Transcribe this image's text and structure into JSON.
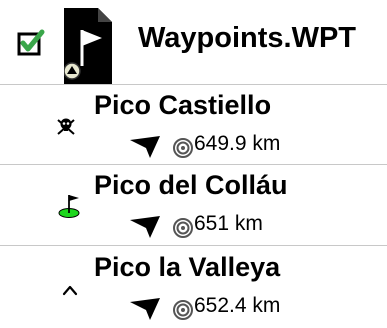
{
  "header": {
    "title": "Waypoints.WPT",
    "checkbox_checked": true,
    "checkbox_icon": "checkbox-checked-icon",
    "file_icon": "waypoint-file-icon"
  },
  "waypoints": [
    {
      "name": "Pico Castiello",
      "symbol_icon": "skull-crossbones-icon",
      "direction_icon": "direction-arrow-icon",
      "distance": "649.9 km"
    },
    {
      "name": "Pico del Colláu",
      "symbol_icon": "golf-flag-icon",
      "direction_icon": "direction-arrow-icon",
      "distance": "651 km"
    },
    {
      "name": "Pico la Valleya",
      "symbol_icon": "summit-caret-icon",
      "direction_icon": "direction-arrow-icon",
      "distance": "652.4 km"
    }
  ],
  "colors": {
    "check_green": "#3aa64a",
    "golf_green": "#1dd61d",
    "divider": "#c8c8c8"
  }
}
